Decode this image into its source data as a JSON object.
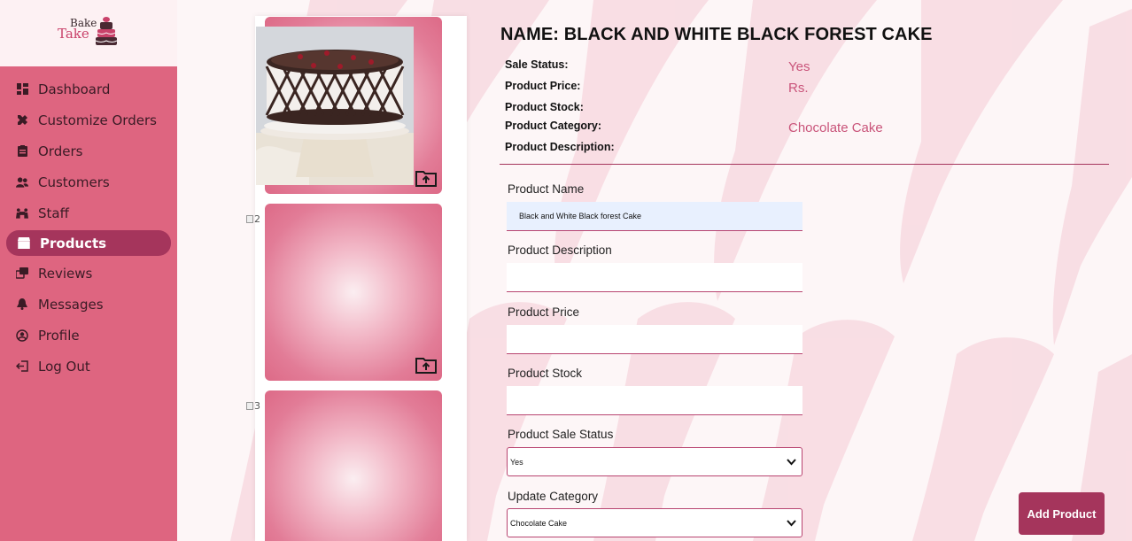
{
  "brand": {
    "line1": "Bake",
    "line2": "Take",
    "accent": "#a5355c",
    "sidebar_color": "#de6580"
  },
  "sidebar": {
    "items": [
      {
        "label": "Dashboard",
        "icon": "dashboard-icon"
      },
      {
        "label": "Customize Orders",
        "icon": "tools-icon"
      },
      {
        "label": "Orders",
        "icon": "clipboard-icon"
      },
      {
        "label": "Customers",
        "icon": "users-icon"
      },
      {
        "label": "Staff",
        "icon": "staff-icon"
      },
      {
        "label": "Products",
        "icon": "store-icon",
        "active": true
      },
      {
        "label": "Reviews",
        "icon": "reviews-icon"
      },
      {
        "label": "Messages",
        "icon": "bell-icon"
      },
      {
        "label": "Profile",
        "icon": "user-circle-icon"
      },
      {
        "label": "Log Out",
        "icon": "logout-icon"
      }
    ]
  },
  "images": {
    "broken_alt_2": "2",
    "broken_alt_3": "3"
  },
  "product": {
    "title": "NAME: BLACK AND WHITE BLACK FOREST CAKE",
    "labels": {
      "sale_status": "Sale Status:",
      "price": "Product Price:",
      "stock": "Product Stock:",
      "category": "Product Category:",
      "description": "Product Description:"
    },
    "values": {
      "sale_status": "Yes",
      "price": "Rs.",
      "category": "Chocolate Cake"
    }
  },
  "form": {
    "name_label": "Product Name",
    "name_value": "Black and White Black forest Cake",
    "description_label": "Product Description",
    "description_value": "",
    "price_label": "Product Price",
    "price_value": "",
    "stock_label": "Product Stock",
    "stock_value": "",
    "sale_status_label": "Product Sale Status",
    "sale_status_value": "Yes",
    "category_label": "Update Category",
    "category_value": "Chocolate Cake",
    "submit_label": "Add Product"
  }
}
